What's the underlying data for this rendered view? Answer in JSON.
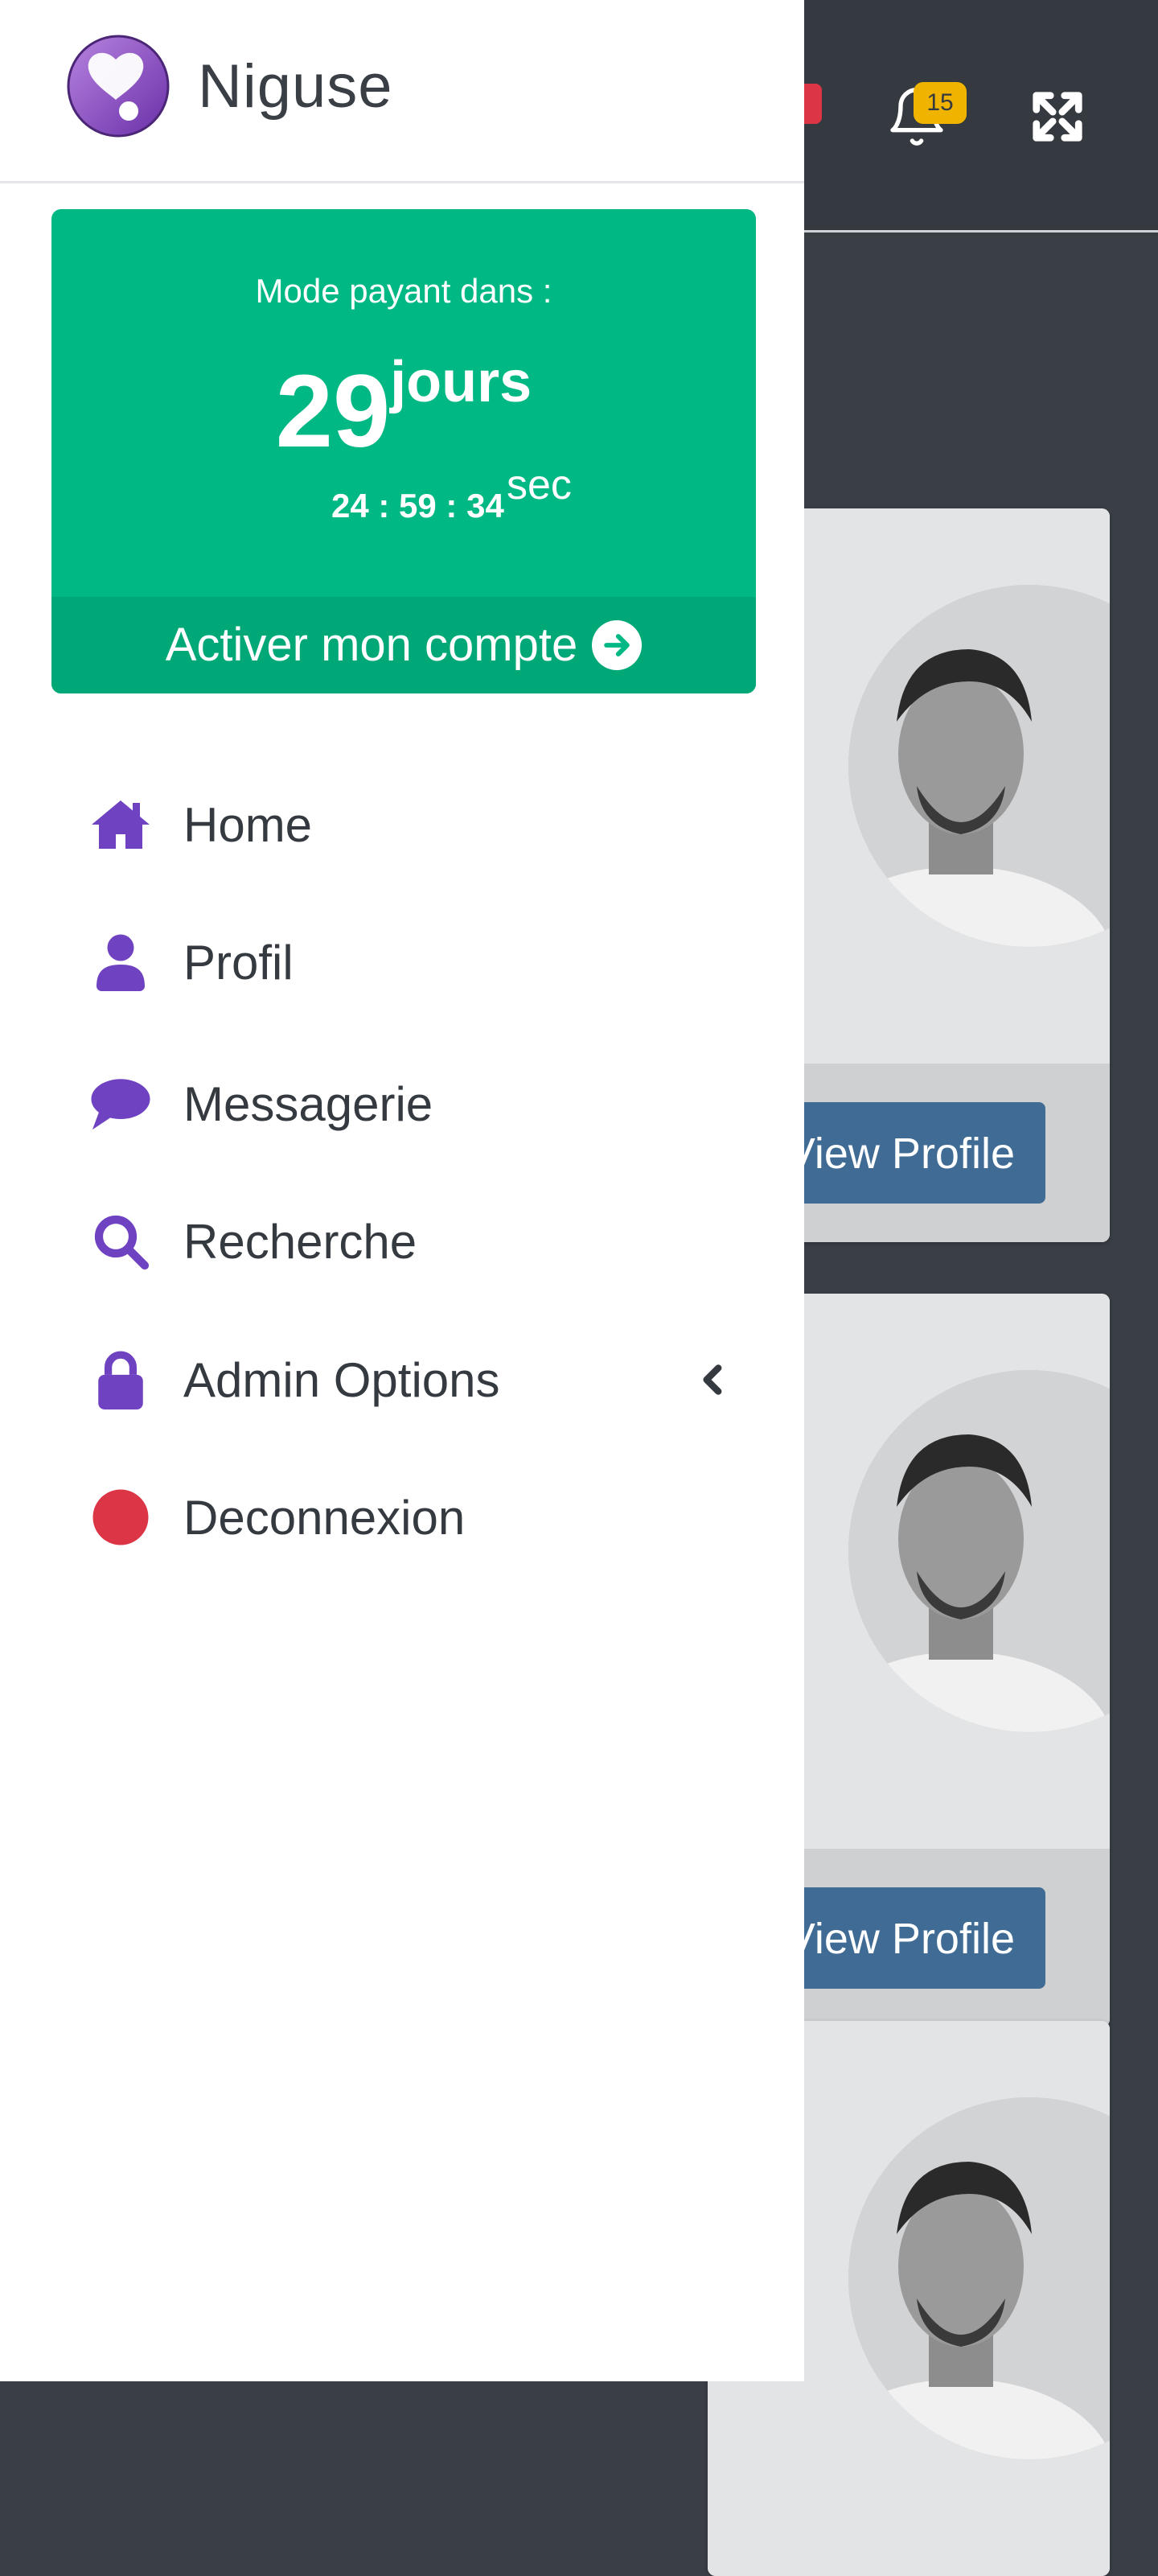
{
  "app": {
    "name": "Niguse"
  },
  "header": {
    "notification_count": "15"
  },
  "promo": {
    "label": "Mode payant dans :",
    "days": "29",
    "days_unit": "jours",
    "time": "24 : 59 : 34",
    "time_unit": "sec",
    "activate_label": "Activer mon compte"
  },
  "nav": {
    "items": [
      {
        "label": "Home",
        "icon": "home-icon"
      },
      {
        "label": "Profil",
        "icon": "user-icon"
      },
      {
        "label": "Messagerie",
        "icon": "chat-bubble-icon"
      },
      {
        "label": "Recherche",
        "icon": "search-icon"
      },
      {
        "label": "Admin Options",
        "icon": "lock-icon"
      },
      {
        "label": "Deconnexion",
        "icon": "red-dot-icon"
      }
    ]
  },
  "cards": [
    {
      "button_label": "View Profile"
    },
    {
      "button_label": "View Profile"
    },
    {
      "button_label": ""
    }
  ],
  "colors": {
    "accent_purple": "#6f42c1",
    "promo_green": "#00b884",
    "badge_yellow": "#f0b400",
    "logout_red": "#dc3545",
    "view_button_blue": "#3f6b95"
  }
}
